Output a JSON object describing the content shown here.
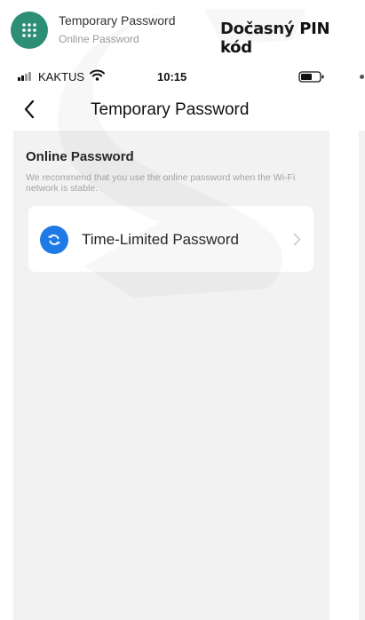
{
  "guide_header": {
    "app_icon": "grid-dots-icon",
    "title": "Temporary Password",
    "subtitle": "Online Password",
    "caption": "Dočasný PIN kód"
  },
  "status_bar": {
    "carrier": "KAKTUS",
    "time": "10:15",
    "signal_icon": "cell-signal-icon",
    "wifi_icon": "wifi-icon",
    "battery_icon": "battery-icon"
  },
  "nav": {
    "back_icon": "chevron-left-icon",
    "title": "Temporary Password"
  },
  "section": {
    "title": "Online Password",
    "note": "We recommend that you use the online password when the Wi-Fi network is stable."
  },
  "items": [
    {
      "label": "Time-Limited Password",
      "icon": "refresh-icon",
      "icon_color": "#1e7ae6"
    }
  ],
  "colors": {
    "app_badge": "#2d8e76",
    "panel_bg": "#f2f2f2",
    "accent": "#1e7ae6"
  }
}
